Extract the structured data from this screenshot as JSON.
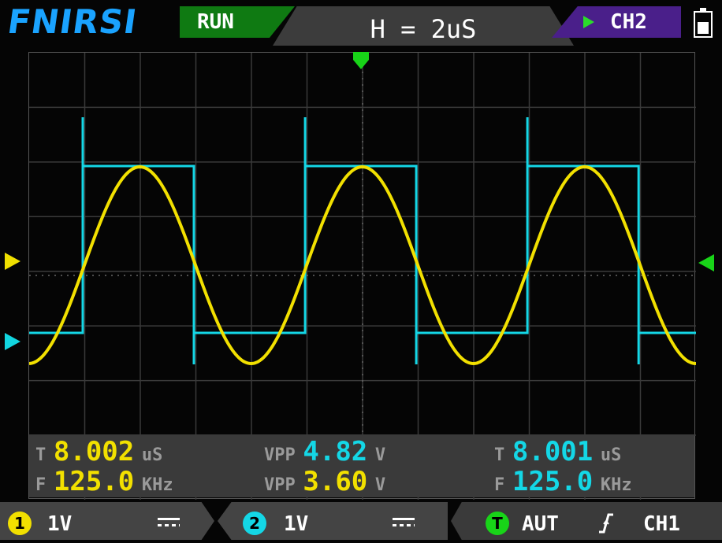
{
  "header": {
    "brand": "FNIRSI",
    "run_state": "RUN",
    "timebase": "H = 2uS",
    "channel_select": "CH2",
    "battery_icon": "battery-full-icon"
  },
  "colors": {
    "ch1": "#f2e000",
    "ch2": "#14d7e6",
    "trigger": "#18d418",
    "run": "#0f7a12",
    "channel_bg": "#4a1f8a"
  },
  "measurements": {
    "ch1_period_label": "T",
    "ch1_period_value": "8.002",
    "ch1_period_unit": "uS",
    "ch1_freq_label": "F",
    "ch1_freq_value": "125.0",
    "ch1_freq_unit": "KHz",
    "vpp1_label": "VPP",
    "vpp1_value": "4.82",
    "vpp1_unit": "V",
    "vpp2_label": "VPP",
    "vpp2_value": "3.60",
    "vpp2_unit": "V",
    "ch2_period_label": "T",
    "ch2_period_value": "8.001",
    "ch2_period_unit": "uS",
    "ch2_freq_label": "F",
    "ch2_freq_value": "125.0",
    "ch2_freq_unit": "KHz"
  },
  "footer": {
    "ch1_badge": "1",
    "ch1_scale": "1V",
    "ch1_coupling_icon": "dc-coupling-icon",
    "ch2_badge": "2",
    "ch2_scale": "1V",
    "ch2_coupling_icon": "dc-coupling-icon",
    "trigger_badge": "T",
    "trigger_mode": "AUT",
    "trigger_edge_icon": "rising-edge-icon",
    "trigger_source": "CH1"
  },
  "chart_data": {
    "type": "line",
    "grid": true,
    "grid_divisions": {
      "x": 12,
      "y": 8
    },
    "timebase_per_div_us": 2,
    "series": [
      {
        "waveform": "sine",
        "color": "#f2e000",
        "period_us": 8.002,
        "vpp_v": 3.6
      },
      {
        "waveform": "square",
        "color": "#14d7e6",
        "period_us": 8.001,
        "vpp_v": 4.82
      }
    ]
  }
}
